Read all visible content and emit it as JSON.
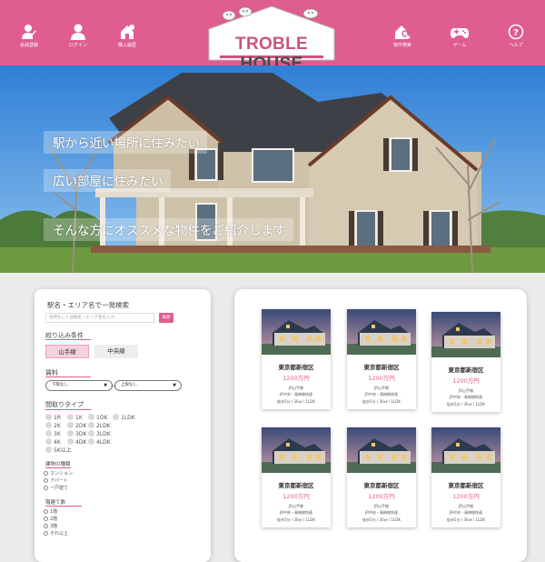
{
  "header": {
    "logo_word1": "TROBLE",
    "logo_word2": "HOUSE",
    "nav": [
      {
        "label": "会員登録",
        "icon": "user-plus-icon"
      },
      {
        "label": "ログイン",
        "icon": "user-icon"
      },
      {
        "label": "購入履歴",
        "icon": "house-history-icon"
      },
      {
        "label": "物件検索",
        "icon": "house-search-icon"
      },
      {
        "label": "ゲーム",
        "icon": "gamepad-icon"
      },
      {
        "label": "ヘルプ",
        "icon": "help-icon"
      }
    ]
  },
  "hero": {
    "line1": "駅から近い場所に住みたい",
    "line2": "広い部屋に住みたい",
    "line3": "そんな方にオススメな物件をご紹介します"
  },
  "search": {
    "title": "駅名・エリア名で一発検索",
    "placeholder": "住所もしくは駅名・エリア名を入力",
    "button": "検索",
    "filter_head": "絞り込み条件",
    "segments": [
      "山手線",
      "中央線"
    ],
    "rent_head": "賃料",
    "rent_min": "下限なし",
    "rent_max": "上限なし",
    "rent_sep": "〜",
    "layout_head": "間取りタイプ",
    "layouts": [
      [
        "1R",
        "1K",
        "1DK",
        "1LDK"
      ],
      [
        "2K",
        "2DK",
        "2LDK"
      ],
      [
        "3K",
        "3DK",
        "3LDK"
      ],
      [
        "4K",
        "4DK",
        "4LDK"
      ],
      [
        "5K以上"
      ]
    ],
    "building_head": "建物の種類",
    "buildings": [
      "マンション",
      "アパート",
      "一戸建て"
    ],
    "floor_head": "階建て数",
    "floors": [
      "1階",
      "2階",
      "3階",
      "それ以上"
    ]
  },
  "listings": [
    {
      "area": "東京都新宿区",
      "price": "1200万円",
      "line1": "JR山手線",
      "line2": "JR中央・青梅線快速",
      "line3": "徒歩5分 / 30㎡ / 1LDK"
    },
    {
      "area": "東京都新宿区",
      "price": "1200万円",
      "line1": "JR山手線",
      "line2": "JR中央・青梅線快速",
      "line3": "徒歩5分 / 30㎡ / 1LDK"
    },
    {
      "area": "東京都新宿区",
      "price": "1200万円",
      "line1": "JR山手線",
      "line2": "JR中央・青梅線快速",
      "line3": "徒歩5分 / 30㎡ / 1LDK"
    },
    {
      "area": "東京都新宿区",
      "price": "1200万円",
      "line1": "JR山手線",
      "line2": "JR中央・青梅線快速",
      "line3": "徒歩5分 / 30㎡ / 1LDK"
    },
    {
      "area": "東京都新宿区",
      "price": "1200万円",
      "line1": "JR山手線",
      "line2": "JR中央・青梅線快速",
      "line3": "徒歩5分 / 30㎡ / 1LDK"
    },
    {
      "area": "東京都新宿区",
      "price": "1200万円",
      "line1": "JR山手線",
      "line2": "JR中央・青梅線快速",
      "line3": "徒歩5分 / 30㎡ / 1LDK"
    }
  ],
  "colors": {
    "accent": "#df5d8f",
    "logo_text": "#c9547f"
  }
}
